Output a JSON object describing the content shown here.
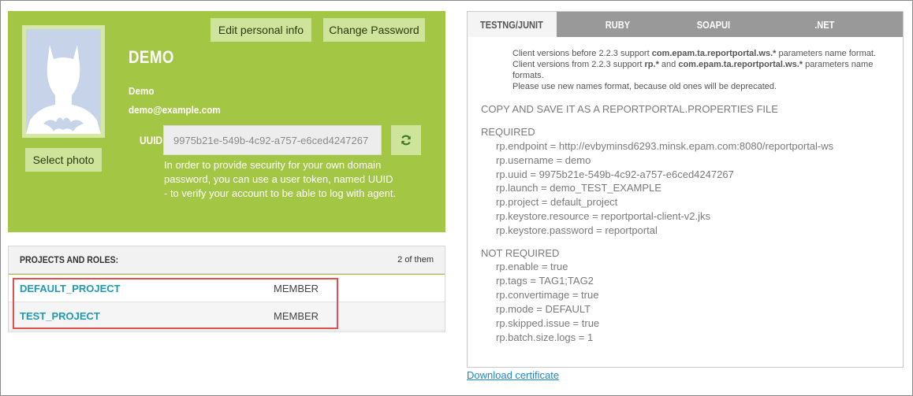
{
  "profile": {
    "username": "DEMO",
    "full_name": "Demo",
    "email": "demo@example.com",
    "select_photo_label": "Select photo",
    "edit_info_label": "Edit personal info",
    "change_password_label": "Change Password",
    "uuid_label": "UUID",
    "uuid_value": "9975b21e-549b-4c92-a757-e6ced4247267",
    "uuid_help": "In order to provide security for your own domain password, you can use a user token, named UUID - to verify your account to be able to log with agent.",
    "avatar_icon": "batman-silhouette-icon",
    "refresh_icon": "refresh-icon"
  },
  "projects": {
    "title": "PROJECTS AND ROLES:",
    "count": "2 of them",
    "rows": [
      {
        "name": "DEFAULT_PROJECT",
        "role": "MEMBER"
      },
      {
        "name": "TEST_PROJECT",
        "role": "MEMBER"
      }
    ]
  },
  "config": {
    "tabs": [
      "TESTNG/JUNIT",
      "RUBY",
      "SOAPUI",
      ".NET"
    ],
    "active_tab": 0,
    "note": {
      "l1a": "Client versions before 2.2.3 support ",
      "l1b": "com.epam.ta.reportportal.ws.*",
      "l1c": " parameters name format.",
      "l2a": "Client versions from 2.2.3 support ",
      "l2b": "rp.*",
      "l2c": " and ",
      "l2d": "com.epam.ta.reportportal.ws.*",
      "l2e": " parameters name formats.",
      "l3": "Please use new names format, because old ones will be deprecated."
    },
    "copy_title": "COPY AND SAVE IT AS A REPORTPORTAL.PROPERTIES FILE",
    "required_title": "REQUIRED",
    "required": [
      "rp.endpoint = http://evbyminsd6293.minsk.epam.com:8080/reportportal-ws",
      "rp.username = demo",
      "rp.uuid = 9975b21e-549b-4c92-a757-e6ced4247267",
      "rp.launch = demo_TEST_EXAMPLE",
      "rp.project = default_project",
      "rp.keystore.resource = reportportal-client-v2.jks",
      "rp.keystore.password = reportportal"
    ],
    "not_required_title": "NOT REQUIRED",
    "not_required": [
      "rp.enable = true",
      "rp.tags = TAG1;TAG2",
      "rp.convertimage = true",
      "rp.mode = DEFAULT",
      "rp.skipped.issue = true",
      "rp.batch.size.logs = 1"
    ]
  },
  "download_label": "Download certificate",
  "colors": {
    "profile_green": "#a3c644",
    "link_blue": "#1e9ab3",
    "highlight_red": "#e0504c"
  }
}
